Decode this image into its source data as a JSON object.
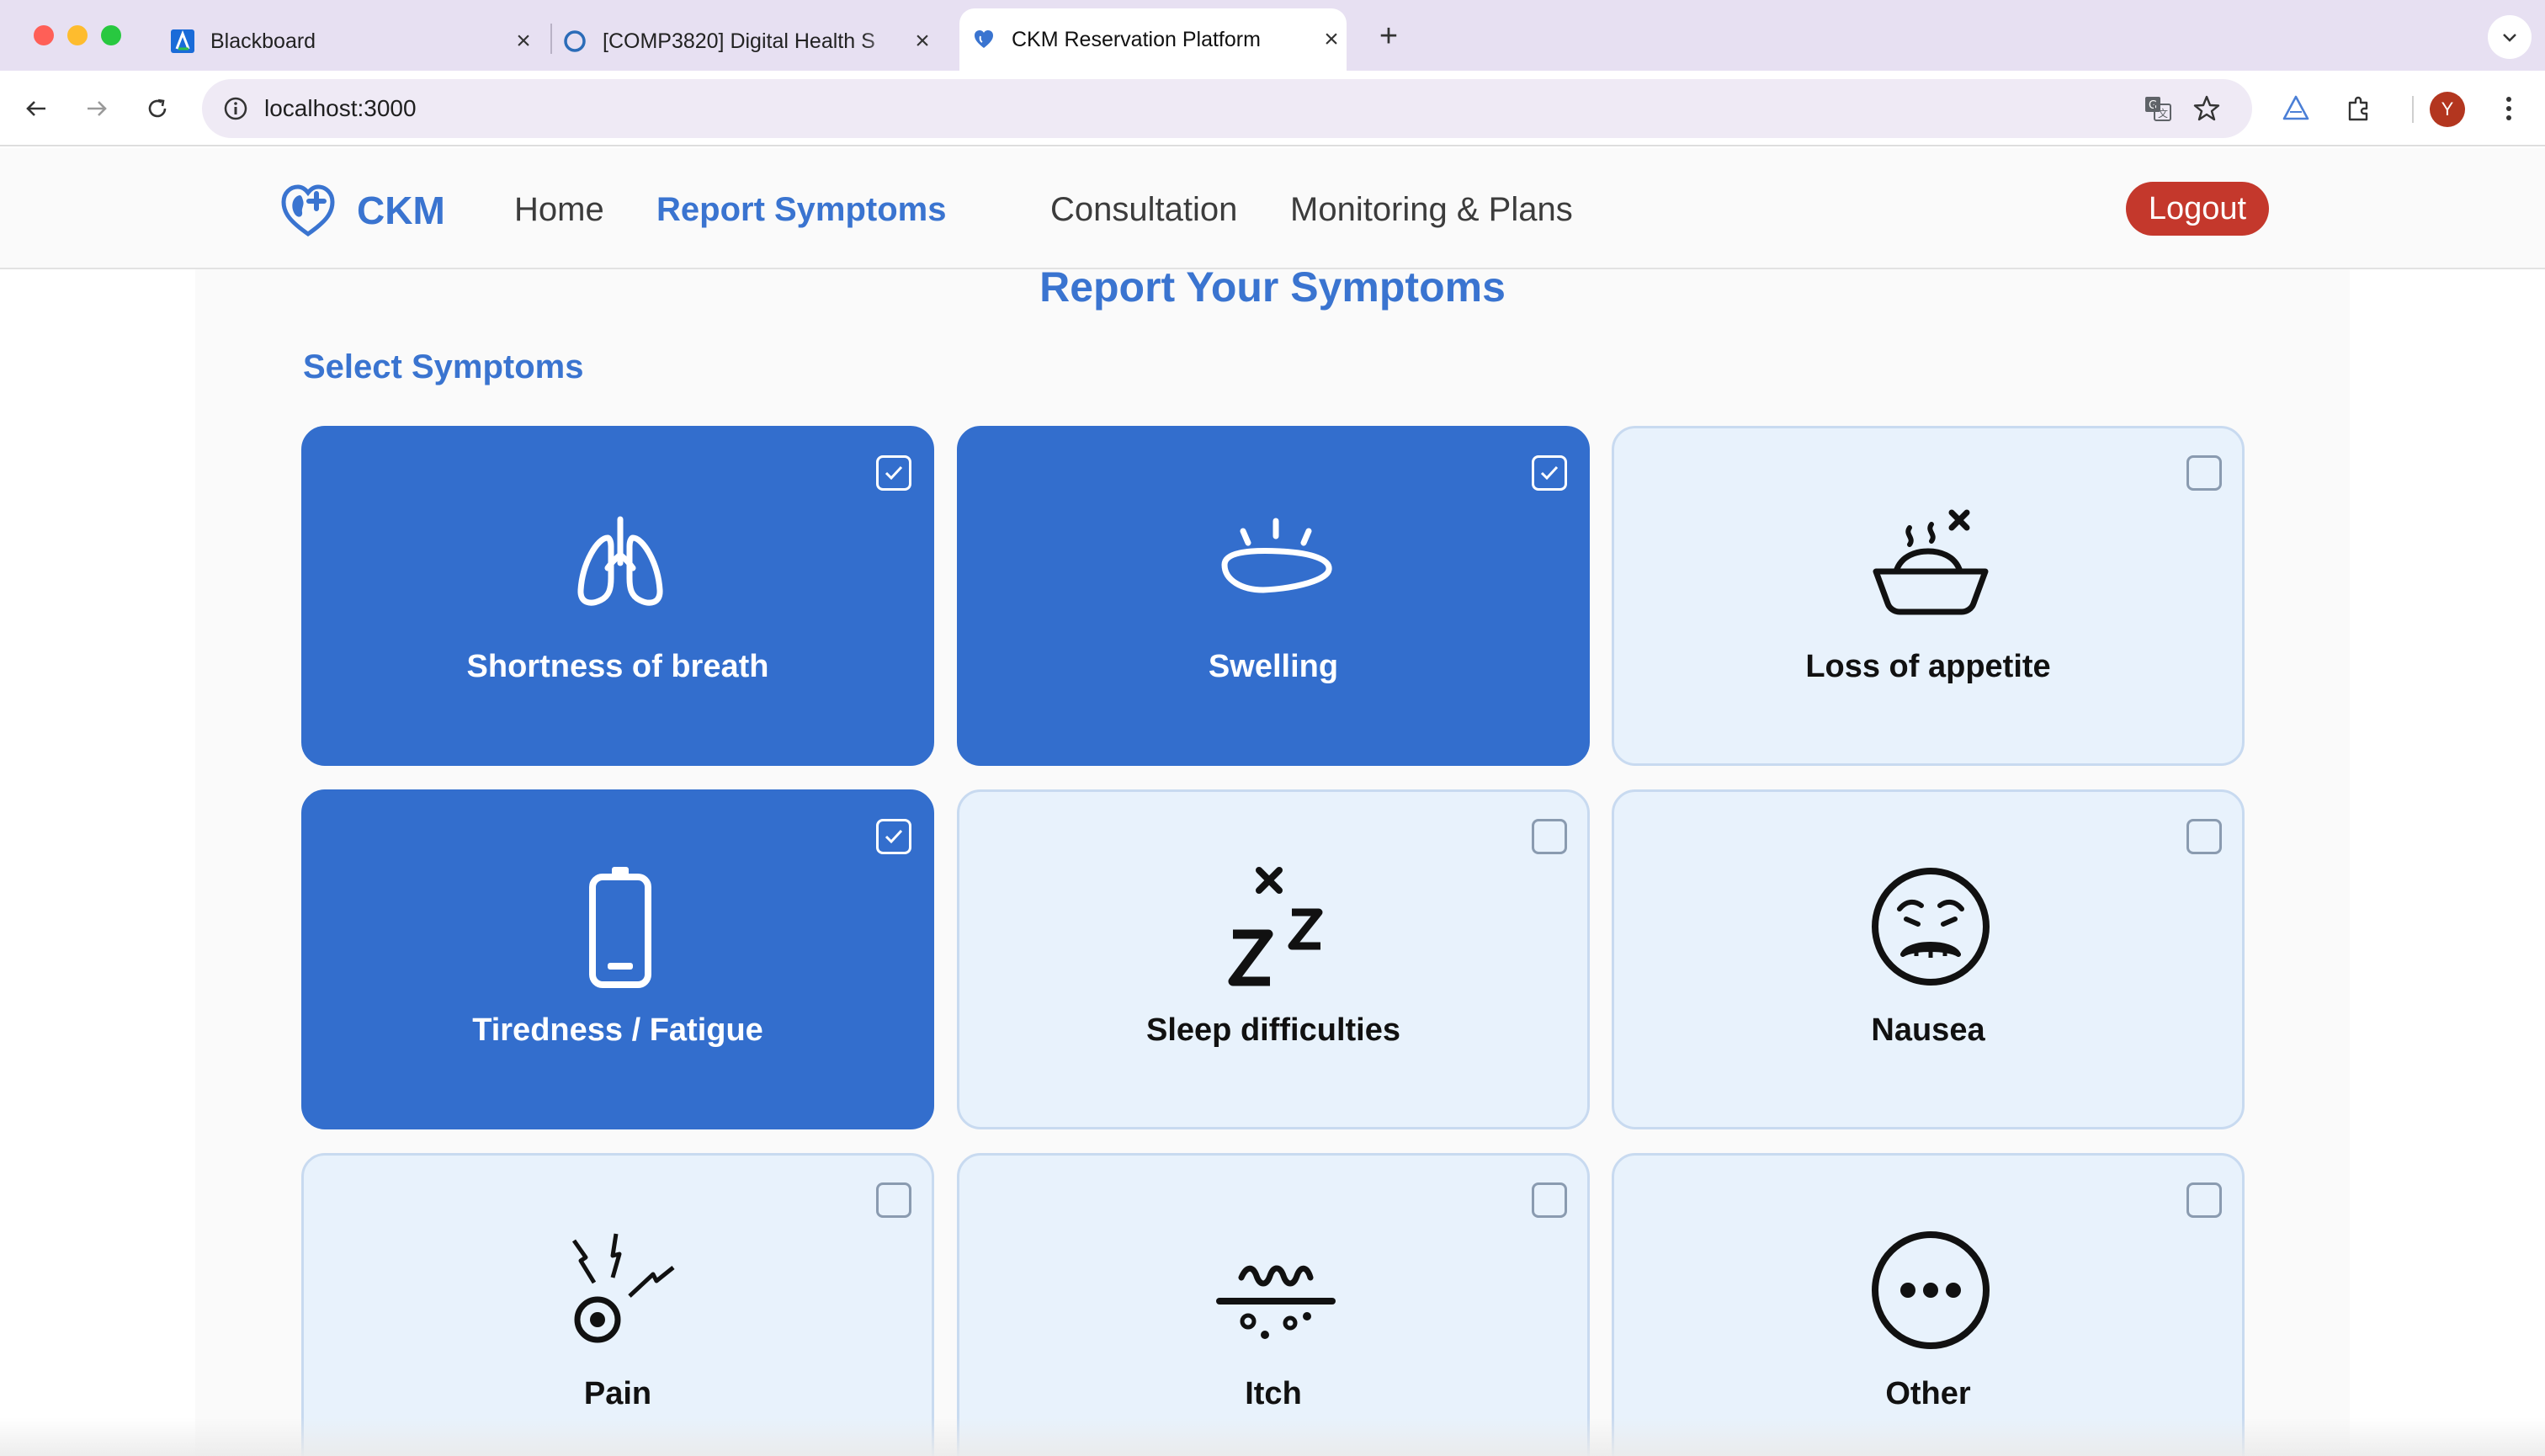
{
  "browser": {
    "tabs": [
      {
        "title": "Blackboard",
        "active": false
      },
      {
        "title": "[COMP3820] Digital Health S",
        "active": false
      },
      {
        "title": "CKM Reservation Platform",
        "active": true
      }
    ],
    "url": "localhost:3000",
    "profile_initial": "Y",
    "new_tab_symbol": "+",
    "close_symbol": "×"
  },
  "app": {
    "brand": "CKM",
    "nav": [
      {
        "label": "Home",
        "active": false
      },
      {
        "label": "Report Symptoms",
        "active": true
      },
      {
        "label": "Consultation",
        "active": false
      },
      {
        "label": "Monitoring & Plans",
        "active": false
      }
    ],
    "logout_label": "Logout"
  },
  "main": {
    "title": "Report Your Symptoms",
    "section_title": "Select Symptoms",
    "symptoms": [
      {
        "label": "Shortness of breath",
        "icon": "lungs-icon",
        "selected": true
      },
      {
        "label": "Swelling",
        "icon": "swelling-icon",
        "selected": true
      },
      {
        "label": "Loss of appetite",
        "icon": "food-bowl-icon",
        "selected": false
      },
      {
        "label": "Tiredness / Fatigue",
        "icon": "battery-low-icon",
        "selected": true
      },
      {
        "label": "Sleep difficulties",
        "icon": "sleep-zz-icon",
        "selected": false
      },
      {
        "label": "Nausea",
        "icon": "nauseous-face-icon",
        "selected": false
      },
      {
        "label": "Pain",
        "icon": "pain-icon",
        "selected": false
      },
      {
        "label": "Itch",
        "icon": "itch-icon",
        "selected": false
      },
      {
        "label": "Other",
        "icon": "more-icon",
        "selected": false
      }
    ]
  },
  "colors": {
    "brand_blue": "#3a74d0",
    "selected_card": "#336ecd",
    "unselected_card": "#e8f2fc",
    "logout_red": "#c4382c"
  }
}
